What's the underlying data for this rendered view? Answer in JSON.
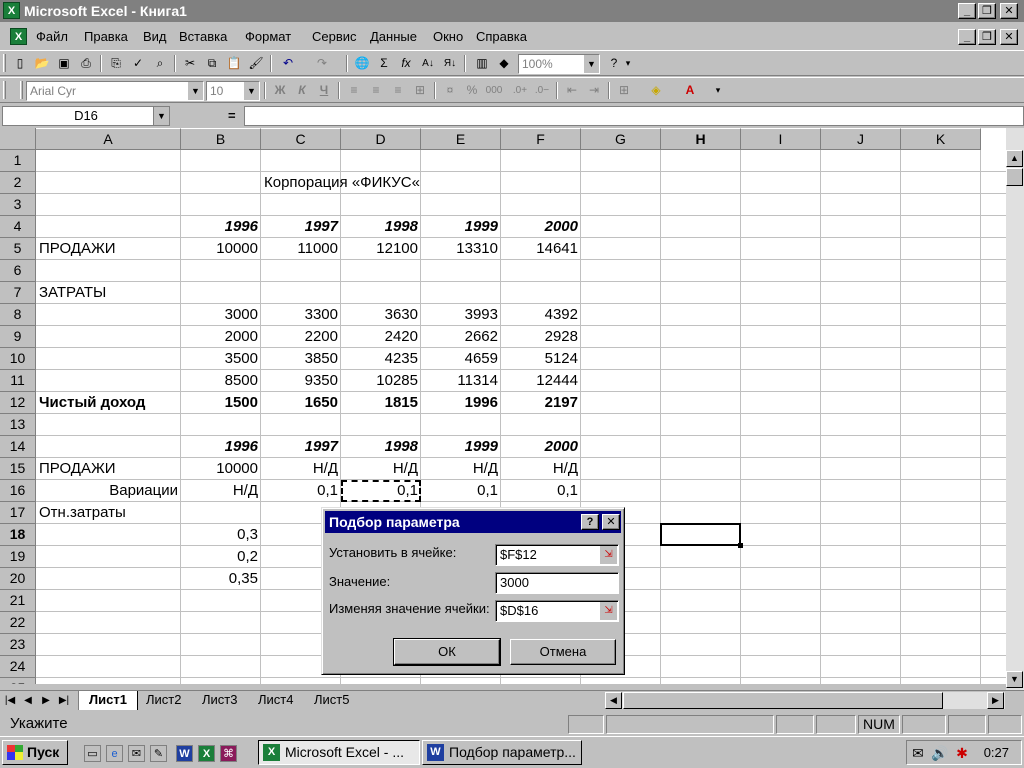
{
  "window": {
    "title": "Microsoft Excel - Книга1",
    "minimize": "_",
    "restore": "❐",
    "close": "✕"
  },
  "menu": {
    "items": [
      "Файл",
      "Правка",
      "Вид",
      "Вставка",
      "Формат",
      "Сервис",
      "Данные",
      "Окно",
      "Справка"
    ]
  },
  "toolbar": {
    "zoom": "100%",
    "font": "Arial Cyr",
    "font_size": "10",
    "bold": "Ж",
    "italic": "К",
    "underline": "Ч",
    "percent": "%",
    "thousands": "000"
  },
  "formula_bar": {
    "name_box": "D16",
    "equals": "="
  },
  "columns": [
    "A",
    "B",
    "C",
    "D",
    "E",
    "F",
    "G",
    "H",
    "I",
    "J",
    "K"
  ],
  "active_column": "H",
  "rows": [
    "1",
    "2",
    "3",
    "4",
    "5",
    "6",
    "7",
    "8",
    "9",
    "10",
    "11",
    "12",
    "13",
    "14",
    "15",
    "16",
    "17",
    "18",
    "19",
    "20",
    "21",
    "22",
    "23",
    "24",
    "25"
  ],
  "active_row": "18",
  "cells": {
    "C2": "Корпорация «ФИКУС«",
    "B4": "1996",
    "C4": "1997",
    "D4": "1998",
    "E4": "1999",
    "F4": "2000",
    "A5": "ПРОДАЖИ",
    "B5": "10000",
    "C5": "11000",
    "D5": "12100",
    "E5": "13310",
    "F5": "14641",
    "A7": "ЗАТРАТЫ",
    "B8": "3000",
    "C8": "3300",
    "D8": "3630",
    "E8": "3993",
    "F8": "4392",
    "B9": "2000",
    "C9": "2200",
    "D9": "2420",
    "E9": "2662",
    "F9": "2928",
    "B10": "3500",
    "C10": "3850",
    "D10": "4235",
    "E10": "4659",
    "F10": "5124",
    "B11": "8500",
    "C11": "9350",
    "D11": "10285",
    "E11": "11314",
    "F11": "12444",
    "A12": "Чистый доход",
    "B12": "1500",
    "C12": "1650",
    "D12": "1815",
    "E12": "1996",
    "F12": "2197",
    "B14": "1996",
    "C14": "1997",
    "D14": "1998",
    "E14": "1999",
    "F14": "2000",
    "A15": "ПРОДАЖИ",
    "B15": "10000",
    "C15": "Н/Д",
    "D15": "Н/Д",
    "E15": "Н/Д",
    "F15": "Н/Д",
    "A16": "Вариации",
    "B16": "Н/Д",
    "C16": "0,1",
    "D16": "0,1",
    "E16": "0,1",
    "F16": "0,1",
    "A17": "Отн.затраты",
    "B18": "0,3",
    "B19": "0,2",
    "B20": "0,35"
  },
  "sheets": {
    "tabs": [
      "Лист1",
      "Лист2",
      "Лист3",
      "Лист4",
      "Лист5"
    ],
    "active": "Лист1"
  },
  "status": {
    "text": "Укажите",
    "num": "NUM"
  },
  "dialog": {
    "title": "Подбор параметра",
    "help": "?",
    "close": "✕",
    "set_cell_label": "Установить в ячейке:",
    "set_cell_value": "$F$12",
    "to_value_label": "Значение:",
    "to_value_value": "3000",
    "changing_cell_label": "Изменяя значение ячейки:",
    "changing_cell_value": "$D$16",
    "ok": "ОК",
    "cancel": "Отмена"
  },
  "taskbar": {
    "start": "Пуск",
    "tasks": [
      "Microsoft Excel - ...",
      "Подбор параметр..."
    ],
    "clock": "0:27"
  },
  "colors": {
    "dialog_title": "#000080",
    "excel_green": "#1a7f3a",
    "face": "#c0c0c0"
  }
}
